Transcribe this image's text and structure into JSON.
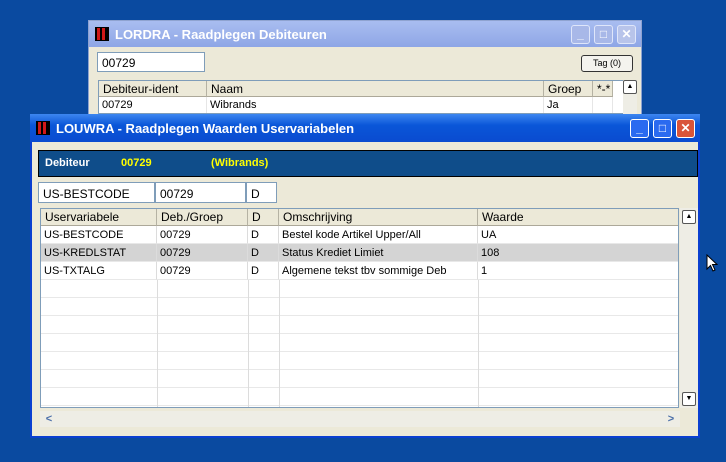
{
  "back_window": {
    "title": "LORDRA - Raadplegen Debiteuren",
    "search_value": "00729",
    "tag_button": "Tag (0)",
    "columns": [
      "Debiteur-ident",
      "Naam",
      "Groep",
      "*-*"
    ],
    "rows": [
      {
        "debiteur": "00729",
        "naam": "Wibrands",
        "groep": "Ja",
        "flag": ""
      }
    ]
  },
  "front_window": {
    "title": "LOUWRA - Raadplegen Waarden Uservariabelen",
    "banner": {
      "label": "Debiteur",
      "code": "00729",
      "name": "(Wibrands)"
    },
    "fields": {
      "variable": "US-BESTCODE",
      "code": "00729",
      "d": "D"
    },
    "columns": [
      "Uservariabele",
      "Deb./Groep",
      "D",
      "Omschrijving",
      "Waarde"
    ],
    "rows": [
      {
        "var": "US-BESTCODE",
        "deb": "00729",
        "d": "D",
        "omschrijving": "Bestel kode Artikel Upper/All",
        "waarde": "UA"
      },
      {
        "var": "US-KREDLSTAT",
        "deb": "00729",
        "d": "D",
        "omschrijving": "Status Krediet Limiet",
        "waarde": "108"
      },
      {
        "var": "US-TXTALG",
        "deb": "00729",
        "d": "D",
        "omschrijving": "Algemene tekst tbv sommige Deb",
        "waarde": "1"
      }
    ],
    "selected_row": 1
  },
  "colors": {
    "desktop": "#0a4aa0",
    "banner_bg": "#0f4d8a",
    "banner_label": "#ffffff",
    "banner_value": "#ffff00",
    "selection": "#d4d4d4"
  },
  "icons": [
    "app-logo-icon",
    "minimize-icon",
    "maximize-icon",
    "close-icon",
    "scroll-up-icon",
    "scroll-down-icon",
    "scroll-left-icon",
    "scroll-right-icon",
    "mouse-cursor-icon"
  ]
}
